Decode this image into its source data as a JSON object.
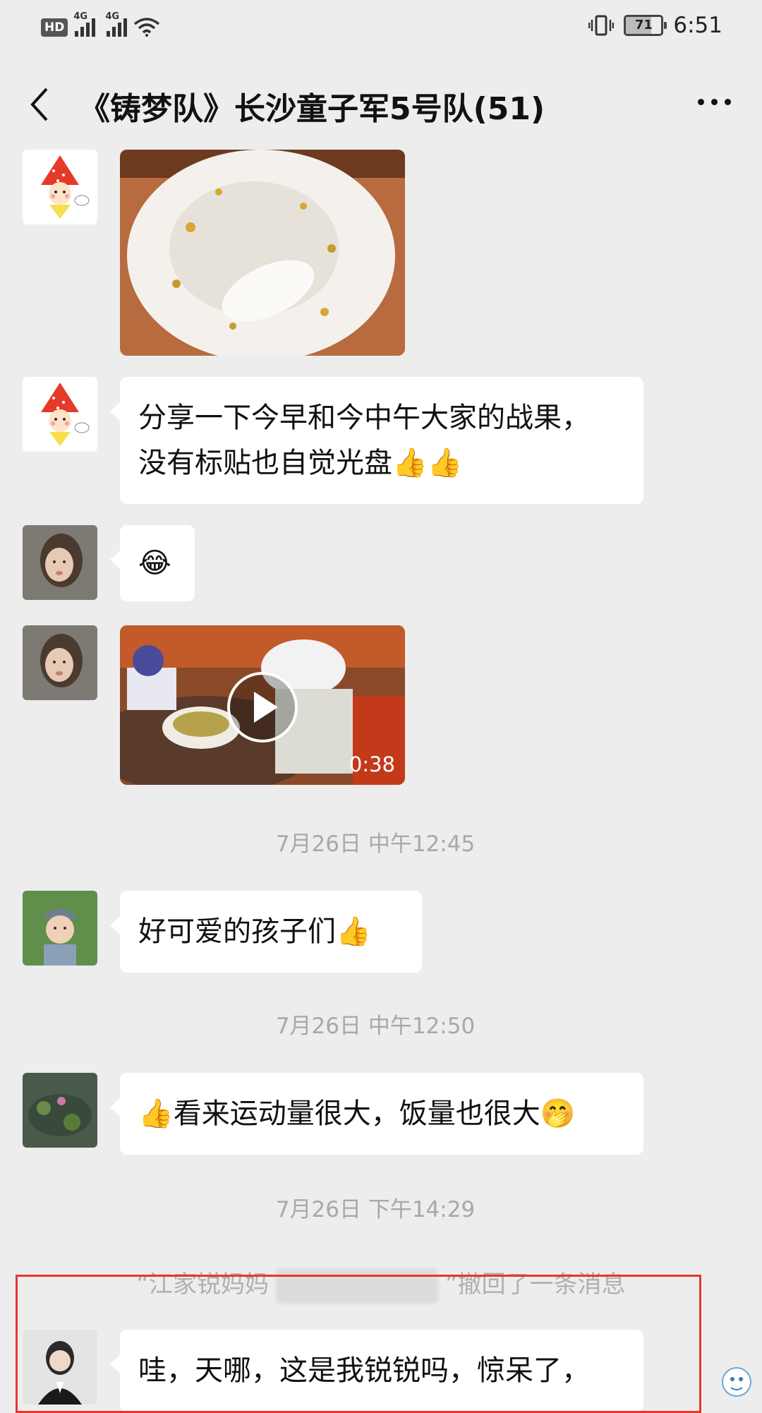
{
  "status_bar": {
    "hd": "HD",
    "network1": "4G",
    "network2": "4G",
    "battery": "71",
    "time": "6:51"
  },
  "header": {
    "title": "《铸梦队》长沙童子军5号队(51)"
  },
  "messages": [
    {
      "type": "image",
      "sender_avatar": "strawberry-girl-avatar"
    },
    {
      "type": "text",
      "text_line1": "分享一下今早和今中午大家的战果，",
      "text_line2": "没有标贴也自觉光盘👍👍"
    },
    {
      "type": "text",
      "text": "😂"
    },
    {
      "type": "video",
      "duration": "0:38"
    },
    {
      "type": "timestamp",
      "text": "7月26日 中午12:45"
    },
    {
      "type": "text",
      "text": "好可爱的孩子们👍"
    },
    {
      "type": "timestamp",
      "text": "7月26日 中午12:50"
    },
    {
      "type": "text",
      "text": "👍看来运动量很大，饭量也很大🤭"
    },
    {
      "type": "timestamp",
      "text": "7月26日 下午14:29"
    },
    {
      "type": "recall",
      "prefix": "“江家锐妈妈",
      "suffix": "”撤回了一条消息"
    },
    {
      "type": "text",
      "text": "哇，天哪，这是我锐锐吗，惊呆了，"
    }
  ],
  "colors": {
    "background": "#ededed",
    "bubble": "#ffffff",
    "highlight_box": "#e8362f",
    "timestamp_text": "#a8a8a8"
  }
}
